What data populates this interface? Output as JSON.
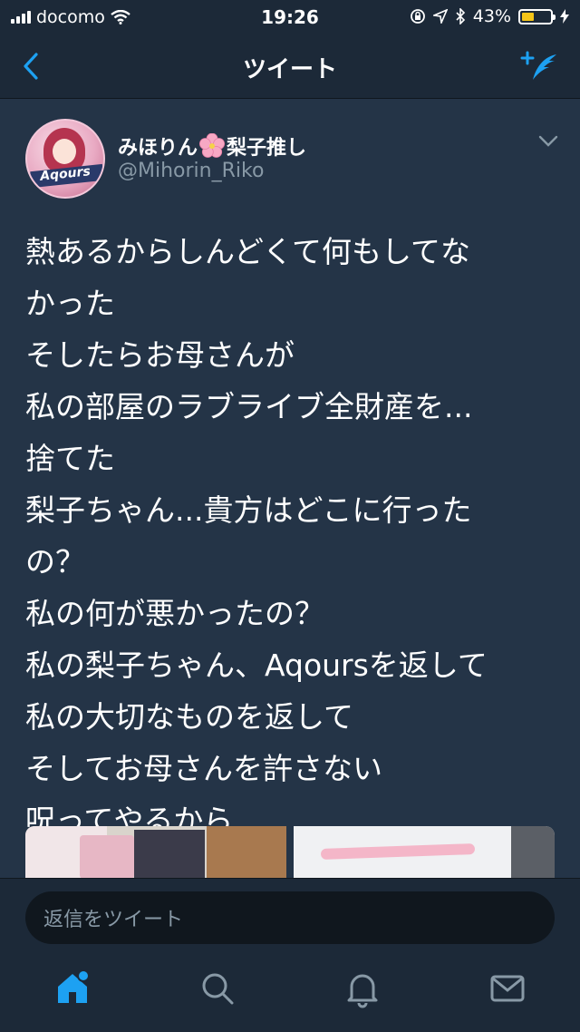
{
  "status_bar": {
    "carrier": "docomo",
    "time": "19:26",
    "battery_percent": "43%",
    "battery_level": 0.43,
    "icons": [
      "signal-icon",
      "wifi-icon",
      "lock-rotation-icon",
      "location-icon",
      "bluetooth-icon",
      "battery-icon",
      "charging-icon"
    ]
  },
  "nav": {
    "title": "ツイート",
    "back_icon": "chevron-left-icon",
    "compose_icon": "compose-tweet-icon"
  },
  "tweet": {
    "display_name_part1": "みほりん",
    "display_name_emoji": "cherry-blossom-emoji",
    "display_name_part2": "梨子推し",
    "handle": "@Mihorin_Riko",
    "avatar_text": "Aqours",
    "lines": [
      "熱あるからしんどくて何もしてな",
      "かった",
      "そしたらお母さんが",
      "私の部屋のラブライブ全財産を...",
      "捨てた",
      "梨子ちゃん...貴方はどこに行った",
      "の？",
      "私の何が悪かったの？",
      "私の梨子ちゃん、Aqoursを返して",
      "私の大切なものを返して",
      "そしてお母さんを許さない",
      "呪ってやるから"
    ]
  },
  "reply": {
    "placeholder": "返信をツイート"
  },
  "tabs": [
    "home-icon",
    "search-icon",
    "notifications-icon",
    "messages-icon"
  ],
  "colors": {
    "background": "#243447",
    "bar": "#1c2938",
    "accent": "#1da1f2",
    "secondary_text": "#8899a6"
  }
}
